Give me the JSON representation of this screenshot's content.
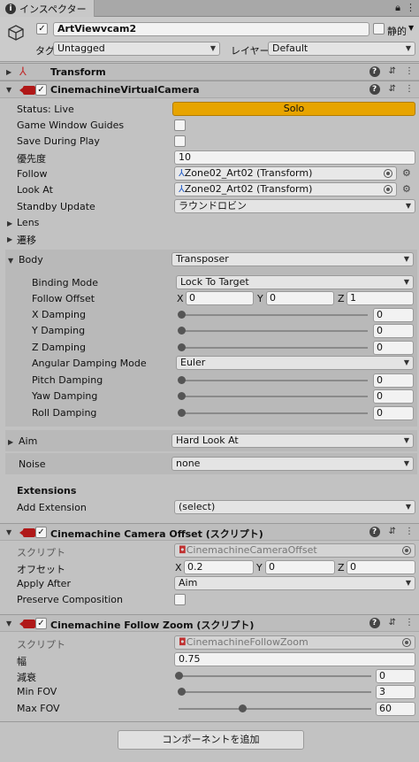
{
  "tab": {
    "title": "インスペクター"
  },
  "object": {
    "name": "ArtViewvcam2",
    "static_label": "静的",
    "tag_label": "タグ",
    "tag_value": "Untagged",
    "layer_label": "レイヤー",
    "layer_value": "Default"
  },
  "transform": {
    "title": "Transform"
  },
  "vcam": {
    "title": "CinemachineVirtualCamera",
    "status_label": "Status: Live",
    "solo_label": "Solo",
    "game_window_guides": "Game Window Guides",
    "save_during_play": "Save During Play",
    "priority_label": "優先度",
    "priority_value": "10",
    "follow_label": "Follow",
    "follow_value": "Zone02_Art02 (Transform)",
    "lookat_label": "Look At",
    "lookat_value": "Zone02_Art02 (Transform)",
    "standby_label": "Standby Update",
    "standby_value": "ラウンドロビン",
    "lens_label": "Lens",
    "transition_label": "遷移",
    "body": {
      "label": "Body",
      "value": "Transposer",
      "binding_mode_label": "Binding Mode",
      "binding_mode_value": "Lock To Target",
      "follow_offset_label": "Follow Offset",
      "offset": {
        "x_label": "X",
        "x": "0",
        "y_label": "Y",
        "y": "0",
        "z_label": "Z",
        "z": "1"
      },
      "x_damping_label": "X Damping",
      "x_damping": "0",
      "x_damping_level": 0,
      "y_damping_label": "Y Damping",
      "y_damping": "0",
      "y_damping_level": 0,
      "z_damping_label": "Z Damping",
      "z_damping": "0",
      "z_damping_level": 0,
      "angular_mode_label": "Angular Damping Mode",
      "angular_mode_value": "Euler",
      "pitch_label": "Pitch Damping",
      "pitch": "0",
      "pitch_level": 0,
      "yaw_label": "Yaw Damping",
      "yaw": "0",
      "yaw_level": 0,
      "roll_label": "Roll Damping",
      "roll": "0",
      "roll_level": 0
    },
    "aim_label": "Aim",
    "aim_value": "Hard Look At",
    "noise_label": "Noise",
    "noise_value": "none",
    "extensions_label": "Extensions",
    "add_extension_label": "Add Extension",
    "add_extension_value": "(select)"
  },
  "offset_comp": {
    "title": "Cinemachine Camera Offset (スクリプト)",
    "script_label": "スクリプト",
    "script_value": "CinemachineCameraOffset",
    "offset_label": "オフセット",
    "offset": {
      "x_label": "X",
      "x": "0.2",
      "y_label": "Y",
      "y": "0",
      "z_label": "Z",
      "z": "0"
    },
    "apply_after_label": "Apply After",
    "apply_after_value": "Aim",
    "preserve_label": "Preserve Composition"
  },
  "zoom_comp": {
    "title": "Cinemachine Follow Zoom (スクリプト)",
    "script_label": "スクリプト",
    "script_value": "CinemachineFollowZoom",
    "width_label": "幅",
    "width_value": "0.75",
    "damping_label": "減衰",
    "damping_value": "0",
    "damping_level": 0,
    "min_fov_label": "Min FOV",
    "min_fov_value": "3",
    "min_fov_level": 0.016,
    "max_fov_label": "Max FOV",
    "max_fov_value": "60",
    "max_fov_level": 0.33
  },
  "add_component_label": "コンポーネントを追加",
  "colors": {
    "solo": "#e7a400",
    "background": "#c2c2c2",
    "header": "#bdbdbd"
  }
}
